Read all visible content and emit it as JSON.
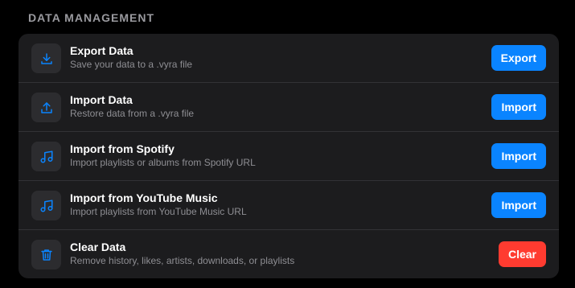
{
  "section": {
    "title": "DATA MANAGEMENT"
  },
  "colors": {
    "accent": "#0a84ff",
    "danger": "#ff3b30"
  },
  "rows": [
    {
      "icon": "download-icon",
      "title": "Export Data",
      "subtitle": "Save your data to a .vyra file",
      "button": "Export"
    },
    {
      "icon": "upload-icon",
      "title": "Import Data",
      "subtitle": "Restore data from a .vyra file",
      "button": "Import"
    },
    {
      "icon": "music-note-icon",
      "title": "Import from Spotify",
      "subtitle": "Import playlists or albums from Spotify URL",
      "button": "Import"
    },
    {
      "icon": "music-note-icon",
      "title": "Import from YouTube Music",
      "subtitle": "Import playlists from YouTube Music URL",
      "button": "Import"
    },
    {
      "icon": "trash-icon",
      "title": "Clear Data",
      "subtitle": "Remove history, likes, artists, downloads, or playlists",
      "button": "Clear"
    }
  ]
}
